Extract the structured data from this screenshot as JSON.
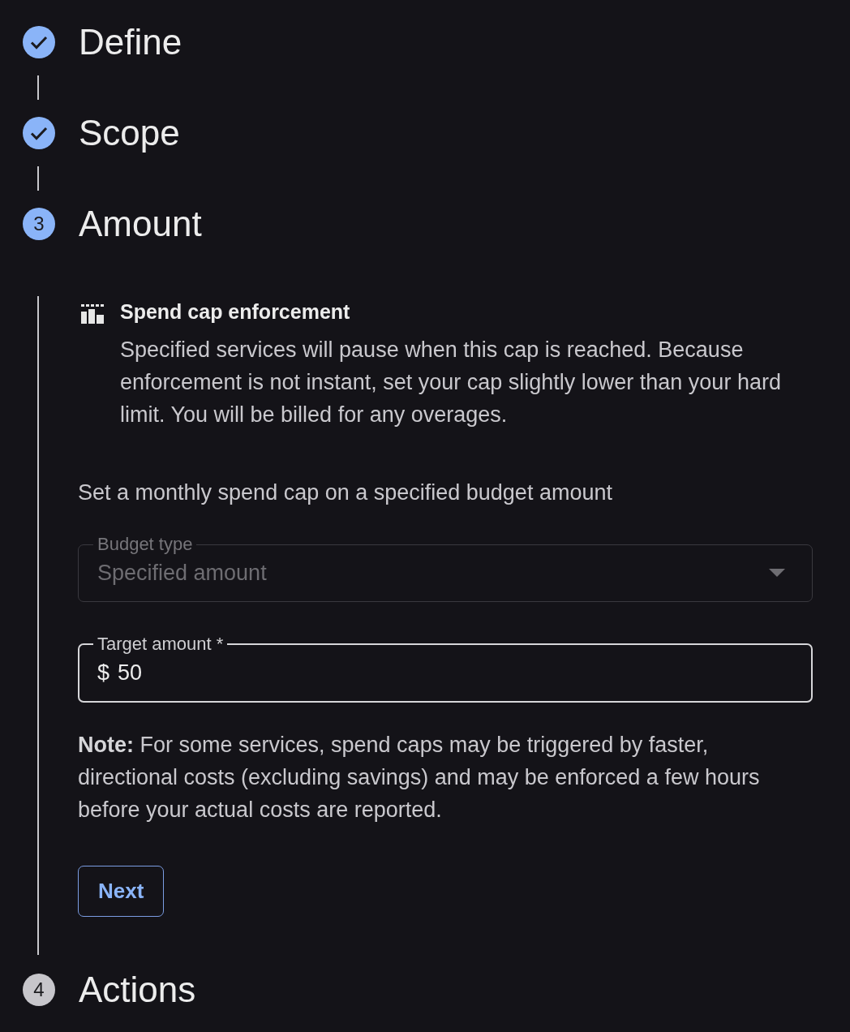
{
  "steps": [
    {
      "title": "Define",
      "completed": true,
      "selected": false
    },
    {
      "title": "Scope",
      "completed": true,
      "selected": false
    },
    {
      "title": "Amount",
      "completed": false,
      "selected": true,
      "number": "3",
      "content": {
        "notice": {
          "title": "Spend cap enforcement",
          "text": "Specified services will pause when this cap is reached. Because enforcement is not instant, set your cap slightly lower than your hard limit. You will be billed for any overages."
        },
        "intro": "Set a monthly spend cap on a specified budget amount",
        "fields": [
          {
            "kind": "select",
            "label": "Budget type",
            "value": "Specified amount",
            "disabled": true
          },
          {
            "kind": "text",
            "label": "Target amount *",
            "prefix": "$",
            "value": "50",
            "disabled": false
          }
        ],
        "note": "**Note:** For some services, spend caps may be triggered by faster, directional costs (excluding savings) and may be enforced a few hours before your actual costs are reported.",
        "button": "Next"
      }
    },
    {
      "title": "Actions",
      "completed": false,
      "selected": false,
      "number": "4"
    }
  ]
}
